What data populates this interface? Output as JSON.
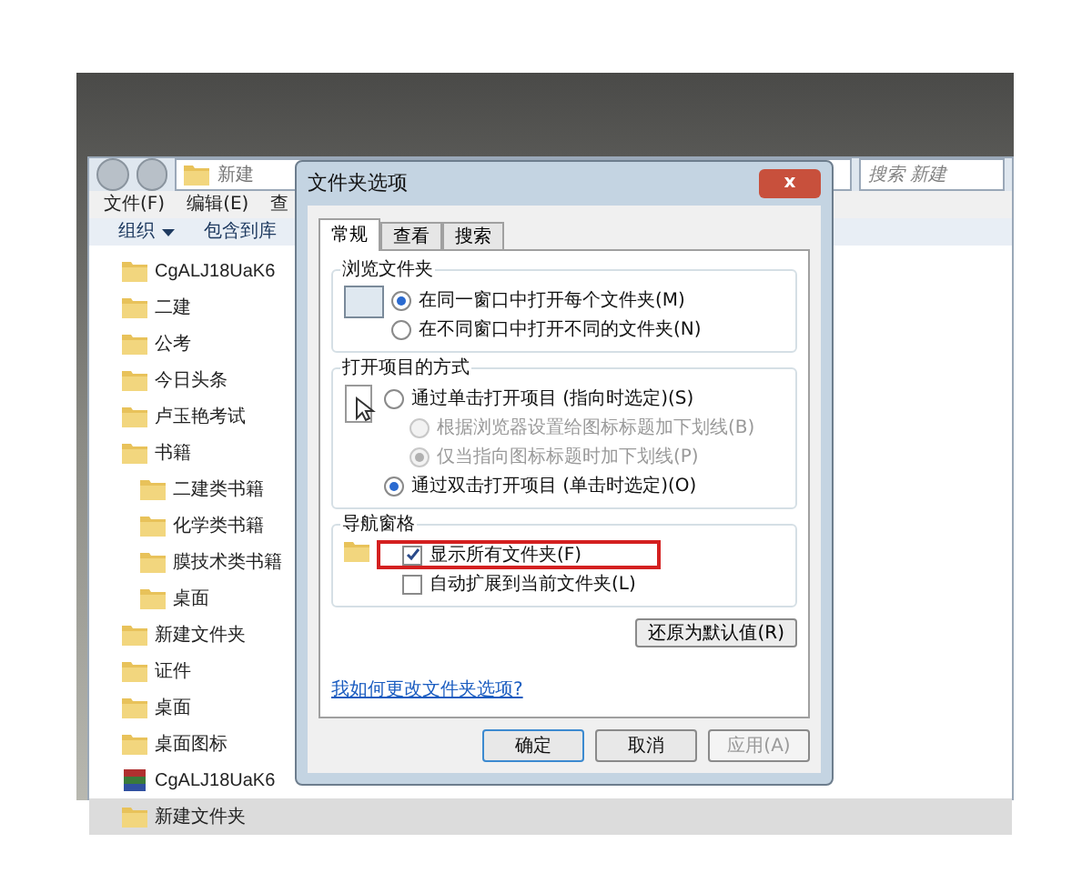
{
  "explorer": {
    "address": "新建",
    "search": {
      "placeholder": "搜索 新建"
    },
    "menu": [
      "文件(F)",
      "编辑(E)",
      "查"
    ],
    "toolbar": [
      "组织",
      "包含到库"
    ],
    "tree": [
      {
        "label": "CgALJ18UaK6",
        "kind": "folder",
        "selected": false
      },
      {
        "label": "二建",
        "kind": "folder",
        "selected": false
      },
      {
        "label": "公考",
        "kind": "folder",
        "selected": false
      },
      {
        "label": "今日头条",
        "kind": "folder",
        "selected": false
      },
      {
        "label": "卢玉艳考试",
        "kind": "folder",
        "selected": false
      },
      {
        "label": "书籍",
        "kind": "folder",
        "selected": false,
        "children": [
          {
            "label": "二建类书籍",
            "kind": "folder",
            "selected": false
          },
          {
            "label": "化学类书籍",
            "kind": "folder",
            "selected": false
          },
          {
            "label": "膜技术类书籍",
            "kind": "folder",
            "selected": false
          },
          {
            "label": "桌面",
            "kind": "folder",
            "selected": false
          }
        ]
      },
      {
        "label": "新建文件夹",
        "kind": "folder",
        "selected": false
      },
      {
        "label": "证件",
        "kind": "folder",
        "selected": false
      },
      {
        "label": "桌面",
        "kind": "folder",
        "selected": false
      },
      {
        "label": "桌面图标",
        "kind": "folder",
        "selected": false
      },
      {
        "label": "CgALJ18UaK6",
        "kind": "archive",
        "selected": false
      },
      {
        "label": "新建文件夹",
        "kind": "folder",
        "selected": true
      }
    ]
  },
  "dialog": {
    "title": "文件夹选项",
    "close": "x",
    "tabs": [
      {
        "label": "常规",
        "selected": true
      },
      {
        "label": "查看",
        "selected": false
      },
      {
        "label": "搜索",
        "selected": false
      }
    ],
    "browse": {
      "title": "浏览文件夹",
      "options": [
        {
          "label": "在同一窗口中打开每个文件夹(M)",
          "selected": true,
          "disabled": false
        },
        {
          "label": "在不同窗口中打开不同的文件夹(N)",
          "selected": false,
          "disabled": false
        }
      ]
    },
    "open": {
      "title": "打开项目的方式",
      "options": [
        {
          "label": "通过单击打开项目 (指向时选定)(S)",
          "selected": false,
          "disabled": false,
          "children": [
            {
              "label": "根据浏览器设置给图标标题加下划线(B)",
              "selected": false,
              "disabled": true
            },
            {
              "label": "仅当指向图标标题时加下划线(P)",
              "selected": true,
              "disabled": true
            }
          ]
        },
        {
          "label": "通过双击打开项目 (单击时选定)(O)",
          "selected": true,
          "disabled": false
        }
      ]
    },
    "nav": {
      "title": "导航窗格",
      "options": [
        {
          "label": "显示所有文件夹(F)",
          "checked": true,
          "highlighted": true
        },
        {
          "label": "自动扩展到当前文件夹(L)",
          "checked": false,
          "highlighted": false
        }
      ]
    },
    "restore": "还原为默认值(R)",
    "help_link": "我如何更改文件夹选项?",
    "buttons": [
      {
        "label": "确定",
        "disabled": false,
        "default": true
      },
      {
        "label": "取消",
        "disabled": false,
        "default": false
      },
      {
        "label": "应用(A)",
        "disabled": true,
        "default": false
      }
    ]
  }
}
